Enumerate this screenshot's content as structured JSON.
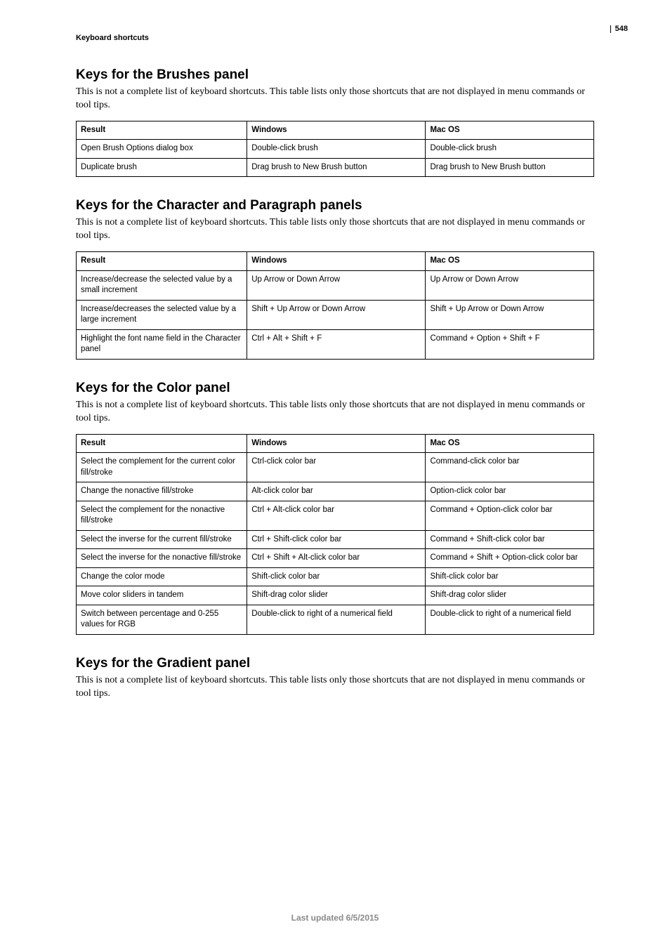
{
  "page_number": "548",
  "breadcrumb": "Keyboard shortcuts",
  "intro_text": "This is not a complete list of keyboard shortcuts. This table lists only those shortcuts that are not displayed in menu commands or tool tips.",
  "columns": {
    "result": "Result",
    "windows": "Windows",
    "macos": "Mac OS"
  },
  "sections": [
    {
      "heading": "Keys for the Brushes panel",
      "rows": [
        {
          "result": "Open Brush Options dialog box",
          "win": "Double-click brush",
          "mac": "Double-click brush"
        },
        {
          "result": "Duplicate brush",
          "win": "Drag brush to New Brush button",
          "mac": "Drag brush to New Brush button"
        }
      ]
    },
    {
      "heading": "Keys for the Character and Paragraph panels",
      "rows": [
        {
          "result": "Increase/decrease the selected value by a small increment",
          "win": "Up Arrow or Down Arrow",
          "mac": "Up Arrow or Down Arrow"
        },
        {
          "result": "Increase/decreases the selected value by a large increment",
          "win": "Shift + Up Arrow or Down Arrow",
          "mac": "Shift + Up Arrow or Down Arrow"
        },
        {
          "result": "Highlight the font name field in the Character panel",
          "win": "Ctrl + Alt + Shift + F",
          "mac": "Command + Option + Shift + F"
        }
      ]
    },
    {
      "heading": "Keys for the Color panel",
      "rows": [
        {
          "result": "Select the complement for the current color fill/stroke",
          "win": "Ctrl-click color bar",
          "mac": "Command-click color bar"
        },
        {
          "result": "Change the nonactive fill/stroke",
          "win": "Alt-click color bar",
          "mac": "Option-click color bar"
        },
        {
          "result": "Select the complement for the nonactive fill/stroke",
          "win": "Ctrl + Alt-click color bar",
          "mac": "Command + Option-click color bar"
        },
        {
          "result": "Select the inverse for the current fill/stroke",
          "win": "Ctrl + Shift-click color bar",
          "mac": "Command + Shift-click color bar"
        },
        {
          "result": "Select the inverse for the nonactive fill/stroke",
          "win": "Ctrl + Shift + Alt-click color bar",
          "mac": "Command + Shift + Option-click color bar"
        },
        {
          "result": "Change the color mode",
          "win": "Shift-click color bar",
          "mac": "Shift-click color bar"
        },
        {
          "result": "Move color sliders in tandem",
          "win": "Shift-drag color slider",
          "mac": "Shift-drag color slider"
        },
        {
          "result": "Switch between percentage and 0-255 values for RGB",
          "win": "Double-click to right of a numerical field",
          "mac": "Double-click to right of a numerical field"
        }
      ]
    },
    {
      "heading": "Keys for the Gradient panel",
      "rows": []
    }
  ],
  "footer": "Last updated 6/5/2015"
}
